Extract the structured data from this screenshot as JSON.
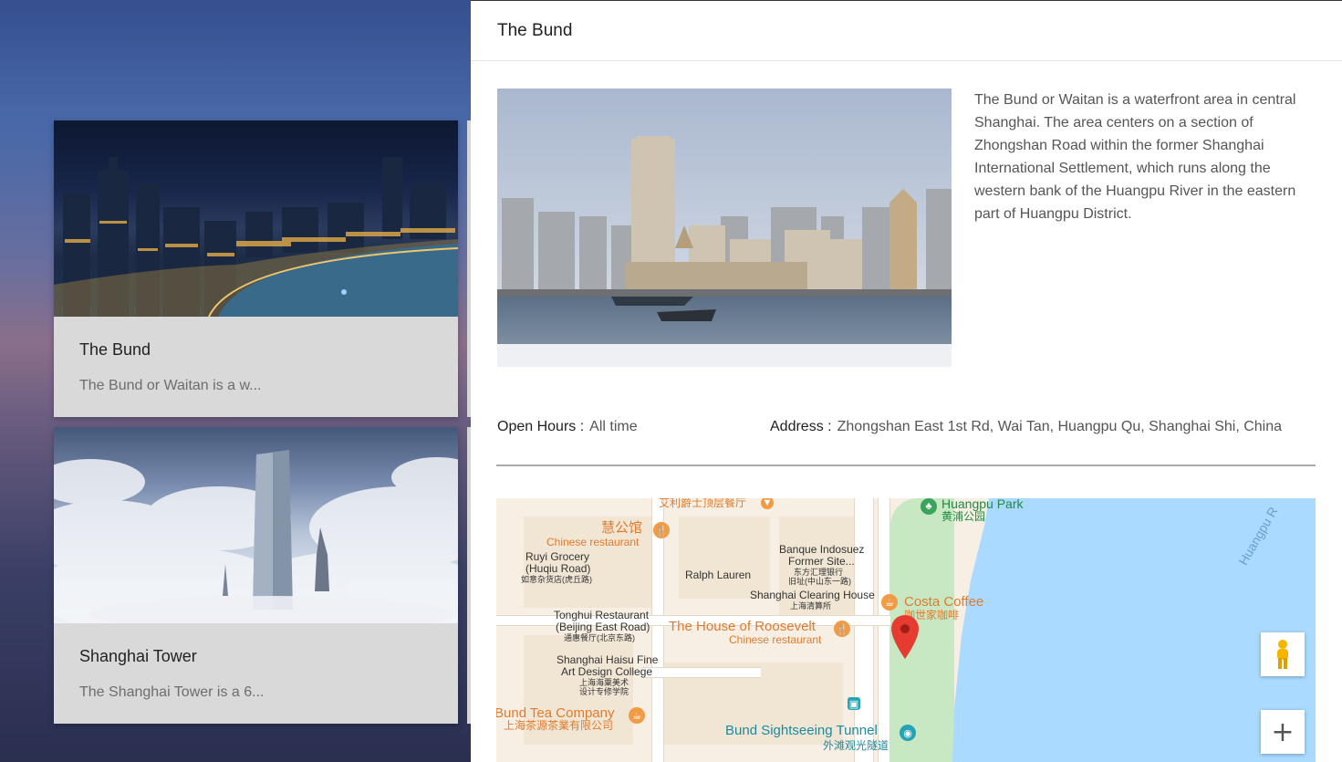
{
  "cards": [
    {
      "title": "The Bund",
      "snippet": "The Bund or Waitan is a w..."
    },
    {
      "title": "Shanghai Tower",
      "snippet": "The Shanghai Tower is a 6..."
    }
  ],
  "detail": {
    "title": "The Bund",
    "description": "The Bund or Waitan is a waterfront area in central Shanghai. The area centers on a section of Zhongshan Road within the former Shanghai International Settlement, which runs along the western bank of the Huangpu River in the eastern part of Huangpu District.",
    "open_hours_label": "Open Hours :",
    "open_hours_value": "All time",
    "address_label": "Address :",
    "address_value": "Zhongshan East 1st Rd, Wai Tan, Huangpu Qu, Shanghai Shi, China"
  },
  "map": {
    "labels": {
      "jazz_bar": "艾利爵士顶层餐厅",
      "huangpu_park": "Huangpu Park",
      "huangpu_park_cn": "黄浦公园",
      "huangpu_river": "Huangpu R",
      "hui_gong_guan": "慧公馆",
      "chinese_restaurant_1": "Chinese restaurant",
      "ruyi_grocery": "Ruyi Grocery",
      "ruyi_grocery_2": "(Huqiu Road)",
      "ruyi_grocery_cn": "如意杂货店(虎丘路)",
      "banque": "Banque Indosuez",
      "banque_2": "Former Site...",
      "banque_cn": "东方汇理银行",
      "banque_cn2": "旧址(中山东一路)",
      "ralph_lauren": "Ralph Lauren",
      "clearing_house": "Shanghai Clearing House",
      "clearing_house_cn": "上海清算所",
      "costa": "Costa Coffee",
      "costa_cn": "咖世家咖啡",
      "tonghui": "Tonghui Restaurant",
      "tonghui_2": "(Beijing East Road)",
      "tonghui_cn": "通惠餐厅(北京东路)",
      "roosevelt": "The House of Roosevelt",
      "chinese_restaurant_2": "Chinese restaurant",
      "haisu": "Shanghai Haisu Fine",
      "haisu_2": "Art Design College",
      "haisu_cn": "上海海粟美术",
      "haisu_cn2": "设计专修学院",
      "tea": "Bund Tea Company",
      "tea_cn": "上海茶源茶業有限公司",
      "tunnel": "Bund Sightseeing Tunnel",
      "tunnel_cn": "外滩观光隧道"
    },
    "zoom_in_symbol": "+"
  }
}
